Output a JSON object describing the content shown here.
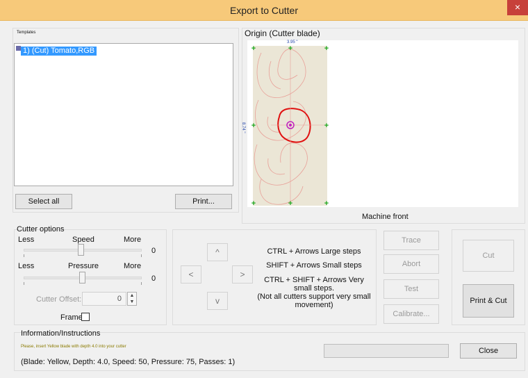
{
  "window": {
    "title": "Export to Cutter",
    "close_glyph": "×"
  },
  "templates": {
    "label": "Templates",
    "items": [
      {
        "label": "1) (Cut) Tomato,RGB",
        "selected": true
      }
    ],
    "select_all_label": "Select all",
    "print_label": "Print..."
  },
  "origin": {
    "label": "Origin (Cutter blade)",
    "width_readout": "3.95 \"",
    "height_readout": "8.74 \"",
    "machine_front_label": "Machine front"
  },
  "cutter_options": {
    "label": "Cutter options",
    "speed": {
      "less": "Less",
      "label": "Speed",
      "more": "More",
      "value": "0",
      "fraction": 0.43
    },
    "pressure": {
      "less": "Less",
      "label": "Pressure",
      "more": "More",
      "value": "0",
      "fraction": 0.43
    },
    "offset": {
      "label": "Cutter Offset:",
      "value": "0"
    },
    "frame": {
      "label": "Frame",
      "checked": false
    }
  },
  "movement": {
    "up": "^",
    "down": "v",
    "left": "<",
    "right": ">",
    "hint1": "CTRL + Arrows  Large steps",
    "hint2": "SHIFT + Arrows  Small steps",
    "hint3": "CTRL + SHIFT + Arrows  Very small steps.",
    "hint4": "(Not all cutters support very small movement)"
  },
  "actions": {
    "trace": "Trace",
    "abort": "Abort",
    "test": "Test",
    "calibrate": "Calibrate...",
    "cut": "Cut",
    "print_cut": "Print & Cut"
  },
  "info": {
    "label": "Information/Instructions",
    "message": "Please, insert Yellow blade with depth 4.0 into your cutter",
    "details": "(Blade: Yellow,  Depth: 4.0, Speed: 50, Pressure: 75, Passes: 1)",
    "close_label": "Close"
  },
  "colors": {
    "cut_path": "#e01010",
    "origin_marker": "#c020c0",
    "markers": "#1ea71e"
  }
}
